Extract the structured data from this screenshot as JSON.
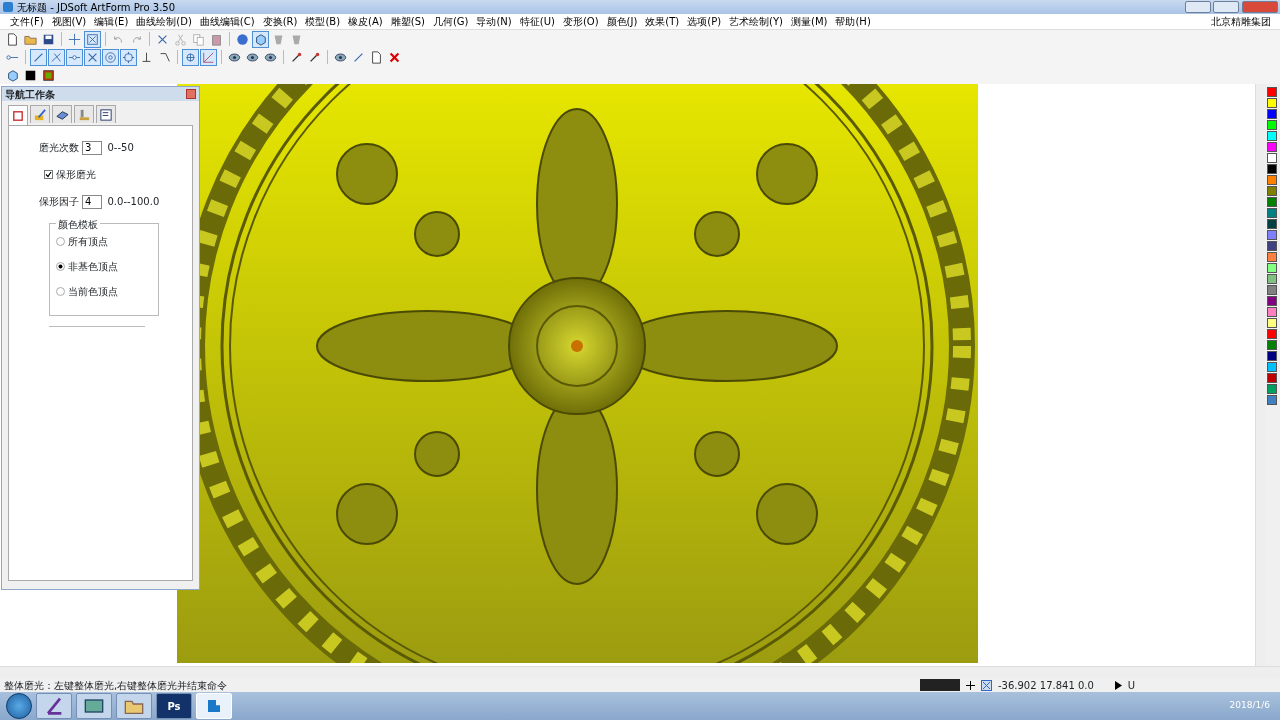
{
  "window": {
    "title": "无标题 - JDSoft ArtForm Pro 3.50"
  },
  "menu": [
    "文件(F)",
    "视图(V)",
    "编辑(E)",
    "曲线绘制(D)",
    "曲线编辑(C)",
    "变换(R)",
    "模型(B)",
    "橡皮(A)",
    "雕塑(S)",
    "几何(G)",
    "导动(N)",
    "特征(U)",
    "变形(O)",
    "颜色(J)",
    "效果(T)",
    "选项(P)",
    "艺术绘制(Y)",
    "测量(M)",
    "帮助(H)"
  ],
  "company": "北京精雕集团",
  "toolbars": [
    [
      {
        "kind": "doc",
        "pressed": false
      },
      {
        "kind": "open",
        "pressed": false
      },
      {
        "kind": "save",
        "pressed": false
      },
      {
        "kind": "sep"
      },
      {
        "kind": "cross",
        "pressed": false
      },
      {
        "kind": "boxx",
        "pressed": true
      },
      {
        "kind": "sep"
      },
      {
        "kind": "undo",
        "pressed": false
      },
      {
        "kind": "redo",
        "pressed": false
      },
      {
        "kind": "sep"
      },
      {
        "kind": "x",
        "pressed": false
      },
      {
        "kind": "scissors",
        "pressed": false
      },
      {
        "kind": "copy",
        "pressed": false
      },
      {
        "kind": "paste",
        "pressed": false
      },
      {
        "kind": "sep"
      },
      {
        "kind": "sphere",
        "pressed": false
      },
      {
        "kind": "cube",
        "pressed": true
      },
      {
        "kind": "cup",
        "pressed": false
      },
      {
        "kind": "cup",
        "pressed": false
      }
    ],
    [
      {
        "kind": "link",
        "pressed": false
      },
      {
        "kind": "sep"
      },
      {
        "kind": "line",
        "pressed": true
      },
      {
        "kind": "perp",
        "pressed": true
      },
      {
        "kind": "mid",
        "pressed": true
      },
      {
        "kind": "x",
        "pressed": true
      },
      {
        "kind": "ring",
        "pressed": true
      },
      {
        "kind": "diamond",
        "pressed": true
      },
      {
        "kind": "tee",
        "pressed": false
      },
      {
        "kind": "bend",
        "pressed": false
      },
      {
        "kind": "sep"
      },
      {
        "kind": "plus",
        "pressed": true
      },
      {
        "kind": "grid",
        "pressed": true
      },
      {
        "kind": "sep"
      },
      {
        "kind": "eye",
        "pressed": false
      },
      {
        "kind": "eye",
        "pressed": false
      },
      {
        "kind": "eye",
        "pressed": false
      },
      {
        "kind": "sep"
      },
      {
        "kind": "pin",
        "pressed": false
      },
      {
        "kind": "pin",
        "pressed": false
      },
      {
        "kind": "sep"
      },
      {
        "kind": "eye",
        "pressed": false
      },
      {
        "kind": "line",
        "pressed": false
      },
      {
        "kind": "doc",
        "pressed": false
      },
      {
        "kind": "redx",
        "pressed": false
      }
    ],
    [
      {
        "kind": "cube",
        "pressed": false
      },
      {
        "kind": "black",
        "pressed": false
      },
      {
        "kind": "gradient",
        "pressed": false
      }
    ]
  ],
  "nav_panel": {
    "title": "导航工作条",
    "tabs": [
      {
        "kind": "square",
        "selected": true
      },
      {
        "kind": "brush",
        "selected": false
      },
      {
        "kind": "slab",
        "selected": false
      },
      {
        "kind": "tool",
        "selected": false
      },
      {
        "kind": "form",
        "selected": false
      }
    ],
    "fields": [
      {
        "label": "磨光次数",
        "value": "3",
        "range": "0--50"
      },
      {
        "label": "保形因子",
        "value": "4",
        "range": "0.0--100.0"
      }
    ],
    "checkbox": {
      "label": "保形磨光",
      "checked": true
    },
    "group": {
      "title": "颜色模板",
      "options": [
        {
          "label": "所有顶点",
          "selected": false
        },
        {
          "label": "非基色顶点",
          "selected": true
        },
        {
          "label": "当前色顶点",
          "selected": false
        }
      ]
    }
  },
  "palette": [
    {
      "color": "#ff0000"
    },
    {
      "color": "#ffff00"
    },
    {
      "color": "#0000ff"
    },
    {
      "color": "#00ff00"
    },
    {
      "color": "#00ffff"
    },
    {
      "color": "#ff00ff"
    },
    {
      "color": "#ffffff"
    },
    {
      "color": "#000000"
    },
    {
      "color": "#ff8000"
    },
    {
      "color": "#808000"
    },
    {
      "color": "#008000"
    },
    {
      "color": "#008080"
    },
    {
      "color": "#004040"
    },
    {
      "color": "#8080ff"
    },
    {
      "color": "#404080"
    },
    {
      "color": "#ff8040"
    },
    {
      "color": "#80ff80"
    },
    {
      "color": "#80c080"
    },
    {
      "color": "#808080"
    },
    {
      "color": "#800080"
    },
    {
      "color": "#ff80c0"
    },
    {
      "color": "#ffff80"
    },
    {
      "color": "#ff0000"
    },
    {
      "color": "#008000"
    },
    {
      "color": "#000080"
    },
    {
      "color": "#00c0ff"
    },
    {
      "color": "#c00000"
    },
    {
      "color": "#00a060"
    },
    {
      "color": "#4080c0"
    }
  ],
  "status": {
    "message": "整体磨光：左键整体磨光,右键整体磨光并结束命令",
    "coordinates": "-36.902 17.841 0.0",
    "unit": "U"
  },
  "taskbar": {
    "apps": [
      {
        "kind": "app",
        "selected": false
      },
      {
        "kind": "photo",
        "selected": false
      },
      {
        "kind": "folder",
        "selected": false
      },
      {
        "kind": "ps",
        "label": "Ps",
        "selected": false
      },
      {
        "kind": "jd",
        "selected": true
      }
    ],
    "date": "2018/1/6"
  }
}
